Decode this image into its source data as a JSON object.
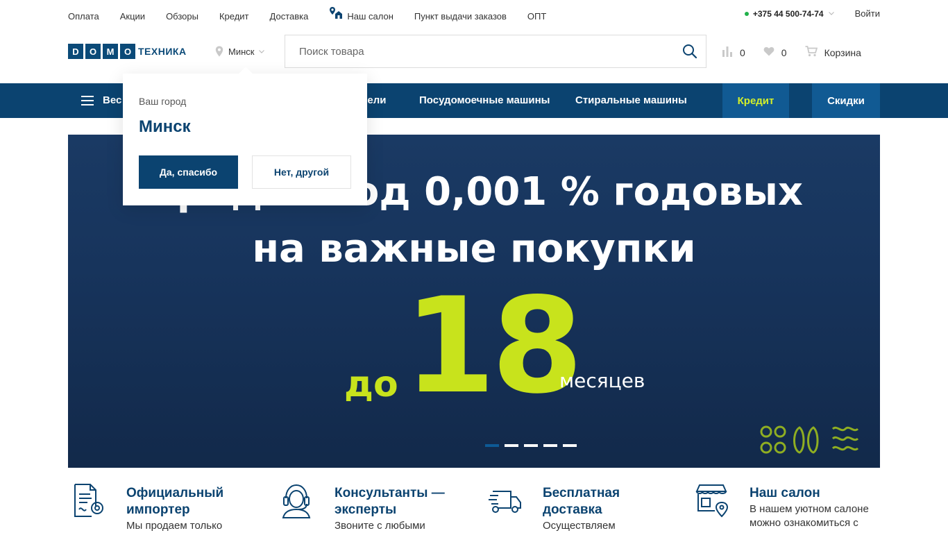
{
  "topbar": {
    "links": [
      "Оплата",
      "Акции",
      "Обзоры",
      "Кредит",
      "Доставка",
      "Наш салон",
      "Пункт выдачи заказов",
      "ОПТ"
    ],
    "phone": "+375 44 500-74-74",
    "login": "Войти"
  },
  "header": {
    "logo_letters": [
      "D",
      "O",
      "M",
      "O"
    ],
    "logo_word": "ТЕХНИКА",
    "city": "Минск",
    "search_placeholder": "Поиск товара",
    "compare_count": "0",
    "favorites_count": "0",
    "cart_label": "Корзина"
  },
  "nav": {
    "catalog_label": "Вес",
    "items": [
      "анели",
      "Посудомоечные машины",
      "Стиральные машины"
    ],
    "credit": "Кредит",
    "discounts": "Скидки"
  },
  "banner": {
    "line1": "Кредит под 0,001 % годовых",
    "line2": "на важные покупки",
    "prefix": "до",
    "big_number": "18",
    "suffix": "месяцев",
    "slides": 5,
    "active_slide": 1
  },
  "city_popup": {
    "question": "Ваш город",
    "city": "Минск",
    "yes": "Да, спасибо",
    "no": "Нет, другой"
  },
  "features": [
    {
      "title": "Официальный импортер",
      "text": "Мы продаем только",
      "icon": "certificate-icon"
    },
    {
      "title": "Консультанты — эксперты",
      "text": "Звоните с любыми",
      "icon": "headset-icon"
    },
    {
      "title": "Бесплатная доставка",
      "text": "Осуществляем",
      "icon": "truck-icon"
    },
    {
      "title": "Наш салон",
      "text": "В нашем уютном салоне можно ознакомиться с",
      "icon": "store-icon"
    }
  ],
  "colors": {
    "primary": "#0b4370",
    "accent": "#c8e31c",
    "nav_highlight": "#115a93",
    "online_dot": "#21b14a"
  }
}
